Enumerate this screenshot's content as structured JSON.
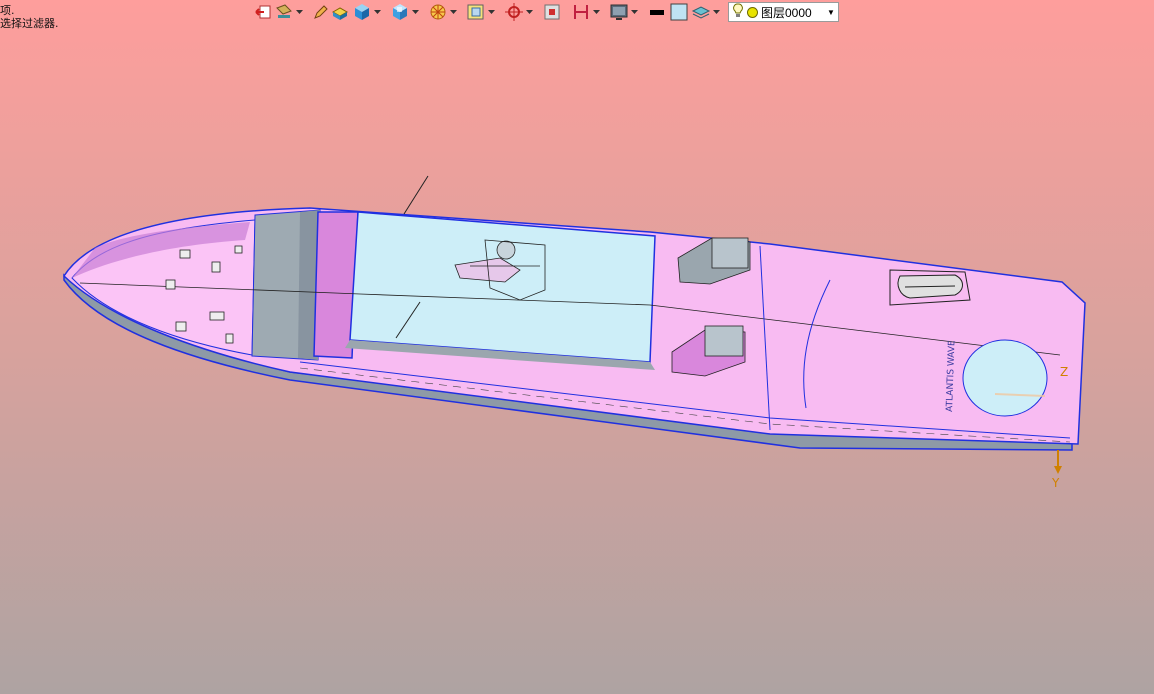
{
  "status_prompt": {
    "line1": "项.",
    "line2": "选择过滤器."
  },
  "toolbar": {
    "icons": [
      "exit-icon",
      "paint-icon",
      "pencil-icon",
      "block-icon",
      "cube-icon",
      "view-cube-icon",
      "circle-pattern-icon",
      "plane-icon",
      "point-icon",
      "frame-icon",
      "section-icon",
      "display-icon",
      "line-color-icon",
      "fill-color-icon",
      "layer-stack-icon"
    ],
    "layer_select": {
      "value": "图层0000",
      "icons": [
        "bulb-icon",
        "layer-color-dot-icon",
        "dropdown-arrow-icon"
      ]
    }
  },
  "viewport": {
    "triad": {
      "z_label": "Z",
      "y_label": "Y"
    },
    "hull_lettering": "ATLANTIS WAVE"
  },
  "colors": {
    "background_top": "#fe9e9c",
    "background_bottom": "#aea3a2",
    "hull_pink": "#f8bbf2",
    "deck_blue": "#cdeef8",
    "edge_blue": "#2030e0",
    "hull_gray": "#9aa8b0",
    "triad_orange": "#d08000"
  }
}
